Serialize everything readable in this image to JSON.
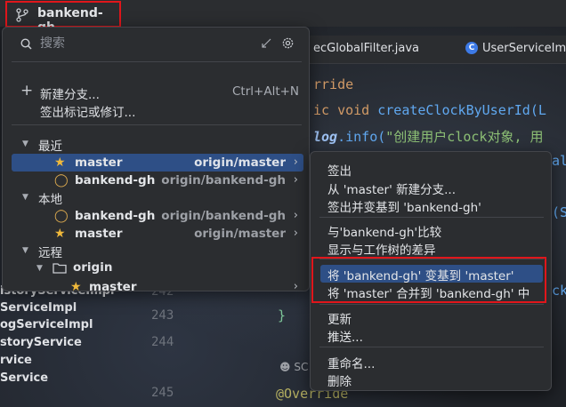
{
  "topbar": {
    "branch": "bankend-gh"
  },
  "editor": {
    "tabs": [
      "ecGlobalFilter.java",
      "UserServiceIm"
    ],
    "code": {
      "l1": "rride",
      "l2a": "ic void ",
      "l2b": "createClockByUserId(",
      "l2c": "L",
      "l3a": "log",
      "l3b": ".info(",
      "l3c": "\"创建用户clock对象, 用",
      "l4": "al",
      "l5": "(S",
      "l6": "ck",
      "anno": "@Override"
    },
    "line_numbers": [
      "242",
      "243",
      "244",
      "245"
    ],
    "usages_hint": "SC"
  },
  "project_tree": [
    "istoryServiceImpl",
    "ServiceImpl",
    "ogServiceImpl",
    "storyService",
    "rvice",
    "Service"
  ],
  "popup": {
    "search_placeholder": "搜索",
    "actions": [
      {
        "label": "新建分支...",
        "shortcut": "Ctrl+Alt+N"
      },
      {
        "label": "签出标记或修订..."
      }
    ],
    "groups": {
      "recent": "最近",
      "local": "本地",
      "remote": "远程",
      "origin": "origin"
    },
    "recent": [
      {
        "name": "master",
        "tracking": "origin/master",
        "icon": "star"
      },
      {
        "name": "bankend-gh",
        "tracking": "origin/bankend-gh",
        "icon": "tag"
      }
    ],
    "local": [
      {
        "name": "bankend-gh",
        "tracking": "origin/bankend-gh",
        "icon": "tag"
      },
      {
        "name": "master",
        "tracking": "origin/master",
        "icon": "star"
      }
    ],
    "remote_master": "master"
  },
  "submenu": {
    "checkout": "签出",
    "new_branch_from": "从 'master' 新建分支...",
    "checkout_rebase": "签出并变基到 'bankend-gh'",
    "compare": "与'bankend-gh'比较",
    "show_diff": "显示与工作树的差异",
    "rebase": "将 'bankend-gh' 变基到 'master'",
    "merge": "将 'master' 合并到 'bankend-gh' 中",
    "update": "更新",
    "push": "推送...",
    "rename": "重命名...",
    "delete": "删除"
  },
  "colors": {
    "highlight": "#2e4f86",
    "annotation_box": "#e0161b",
    "star": "#f0b93b"
  }
}
